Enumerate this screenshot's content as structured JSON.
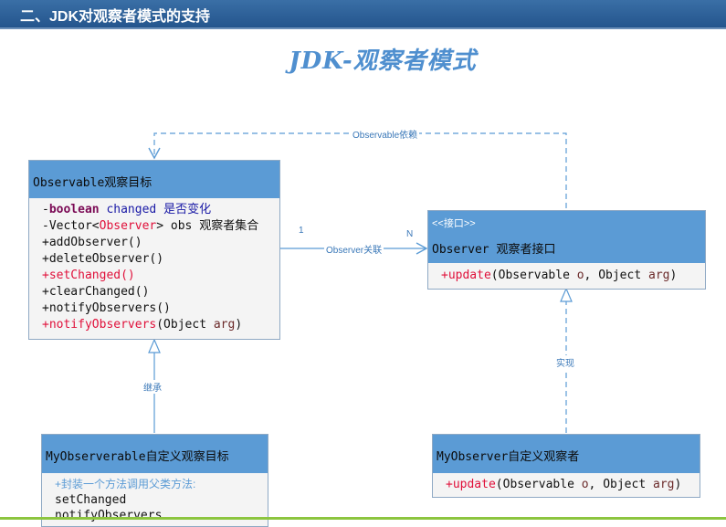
{
  "header": {
    "title": "二、JDK对观察者模式的支持"
  },
  "slide_title": "JDK-观察者模式",
  "observable": {
    "header": "Observable观察目标",
    "row1": {
      "prefix": "-",
      "keyword": "boolean",
      "name": " changed",
      "desc": " 是否变化"
    },
    "row2": {
      "prefix": "-Vector<",
      "type": "Observer",
      "rest": "> obs 观察者集合"
    },
    "methods": [
      "+addObserver()",
      "+deleteObserver()",
      "+setChanged()",
      "+clearChanged()",
      "+notifyObservers()"
    ],
    "notify_name": "+notifyObservers",
    "notify_open": "(Object ",
    "notify_arg": "arg",
    "notify_close": ")"
  },
  "observer": {
    "stereotype": "<<接口>>",
    "header": "Observer 观察者接口",
    "method_name": "+update",
    "method_open": "(Observable ",
    "arg1": "o",
    "method_mid": ", Object ",
    "arg2": "arg",
    "method_close": ")"
  },
  "my_observable": {
    "header": "MyObserverable自定义观察目标",
    "comment": "+封装一个方法调用父类方法:",
    "line1": "setChanged",
    "line2": "notifyObservers"
  },
  "my_observer": {
    "header": "MyObserver自定义观察者",
    "method_name": "+update",
    "method_open": "(Observable ",
    "arg1": "o",
    "method_mid": ", Object ",
    "arg2": "arg",
    "method_close": ")"
  },
  "labels": {
    "dependency": "Observable依赖",
    "association": "Observer关联",
    "mult_one": "1",
    "mult_n": "N",
    "inherit": "继承",
    "implement": "实现"
  },
  "colors": {
    "header_bar": "#24558d",
    "class_header": "#5b9bd5",
    "line": "#5b9bd5",
    "title": "#4f8fcf"
  }
}
